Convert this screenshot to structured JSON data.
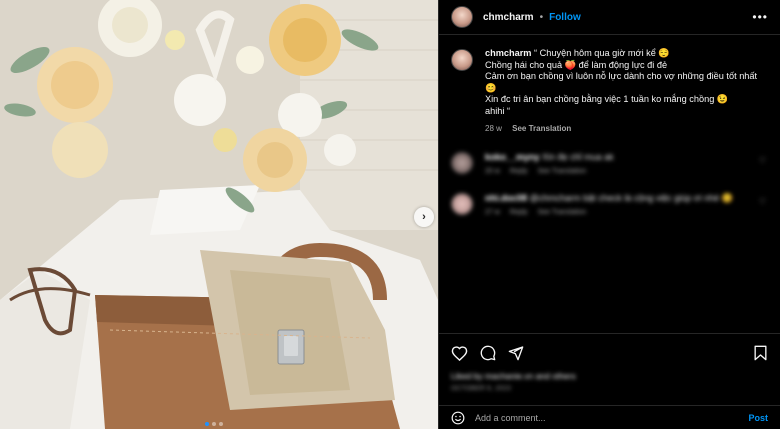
{
  "post": {
    "username": "chmcharm",
    "follow_label": "Follow",
    "separator": "•",
    "more_icon": "more-horizontal-icon"
  },
  "caption": {
    "username": "chmcharm",
    "lines": [
      "“ Chuyện hôm qua giờ mới kể 😌",
      "Chồng hái cho quả 🍑 để làm động lực đi đẻ",
      "Cảm ơn bạn chồng vì luôn nỗ lực dành cho vợ những điều tốt nhất 😊",
      "Xin đc tri ân bạn chồng bằng việc 1 tuần ko mắng chồng 😉",
      "ahihi “"
    ],
    "age": "28 w",
    "see_translation": "See Translation"
  },
  "comments": [
    {
      "user": "koko__myny",
      "text": "Xin đẹ chỉ mua ak",
      "age": "20 w",
      "reply": "Reply",
      "see_translation": "See Translation"
    },
    {
      "user": "nhi.doc08",
      "text": "@chmcharm bật check là cộng việc giúp ơi nhé 😊",
      "age": "27 w",
      "reply": "Reply",
      "see_translation": "See Translation"
    }
  ],
  "actions": {
    "like_icon": "heart-icon",
    "comment_icon": "comment-icon",
    "share_icon": "send-icon",
    "save_icon": "bookmark-icon",
    "liked_by": "Liked by machanie.vn and others",
    "timestamp": "OCTOBER 6, 2023"
  },
  "add_comment": {
    "placeholder": "Add a comment...",
    "post_label": "Post",
    "emoji_icon": "smiley-icon"
  },
  "carousel": {
    "next_label": "›",
    "dots": 3,
    "active_dot": 0
  },
  "colors": {
    "accent": "#0095f6",
    "background": "#000000",
    "secondary_text": "#a8a8a8",
    "border": "#262626"
  }
}
